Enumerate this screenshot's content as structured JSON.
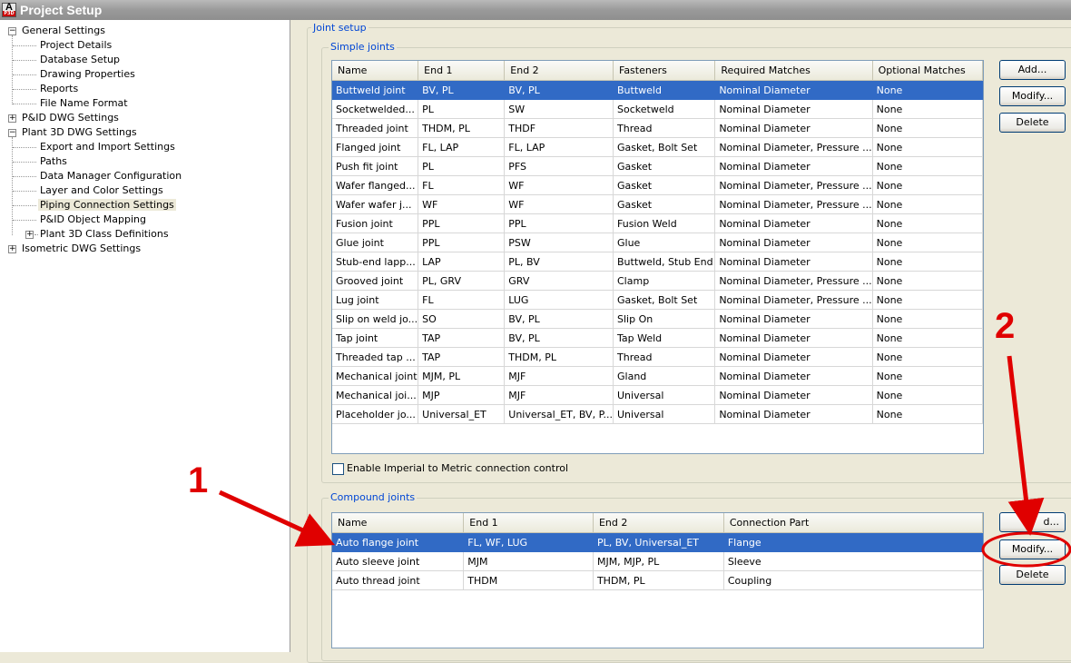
{
  "window": {
    "title": "Project Setup",
    "icon": "autocad-plant3d-icon"
  },
  "tree": [
    {
      "label": "General Settings",
      "level": 0,
      "expander": "minus"
    },
    {
      "label": "Project Details",
      "level": 1
    },
    {
      "label": "Database Setup",
      "level": 1
    },
    {
      "label": "Drawing Properties",
      "level": 1
    },
    {
      "label": "Reports",
      "level": 1
    },
    {
      "label": "File Name Format",
      "level": 1
    },
    {
      "label": "P&ID DWG Settings",
      "level": 0,
      "expander": "plus"
    },
    {
      "label": "Plant 3D DWG Settings",
      "level": 0,
      "expander": "minus"
    },
    {
      "label": "Export and Import Settings",
      "level": 1
    },
    {
      "label": "Paths",
      "level": 1
    },
    {
      "label": "Data Manager Configuration",
      "level": 1
    },
    {
      "label": "Layer and Color Settings",
      "level": 1
    },
    {
      "label": "Piping Connection Settings",
      "level": 1,
      "selected": true
    },
    {
      "label": "P&ID Object Mapping",
      "level": 1
    },
    {
      "label": "Plant 3D Class Definitions",
      "level": 1,
      "expander": "plus"
    },
    {
      "label": "Isometric DWG Settings",
      "level": 0,
      "expander": "plus"
    }
  ],
  "joint_setup": {
    "caption": "Joint setup"
  },
  "simple_joints": {
    "caption": "Simple joints",
    "columns": [
      "Name",
      "End 1",
      "End 2",
      "Fasteners",
      "Required Matches",
      "Optional Matches"
    ],
    "rows": [
      [
        "Buttweld joint",
        "BV, PL",
        "BV, PL",
        "Buttweld",
        "Nominal Diameter",
        "None"
      ],
      [
        "Socketwelded...",
        "PL",
        "SW",
        "Socketweld",
        "Nominal Diameter",
        "None"
      ],
      [
        "Threaded joint",
        "THDM, PL",
        "THDF",
        "Thread",
        "Nominal Diameter",
        "None"
      ],
      [
        "Flanged joint",
        "FL, LAP",
        "FL, LAP",
        "Gasket, Bolt Set",
        "Nominal Diameter, Pressure ...",
        "None"
      ],
      [
        "Push fit joint",
        "PL",
        "PFS",
        "Gasket",
        "Nominal Diameter",
        "None"
      ],
      [
        "Wafer flanged...",
        "FL",
        "WF",
        "Gasket",
        "Nominal Diameter, Pressure ...",
        "None"
      ],
      [
        "Wafer wafer j...",
        "WF",
        "WF",
        "Gasket",
        "Nominal Diameter, Pressure ...",
        "None"
      ],
      [
        "Fusion joint",
        "PPL",
        "PPL",
        "Fusion Weld",
        "Nominal Diameter",
        "None"
      ],
      [
        "Glue joint",
        "PPL",
        "PSW",
        "Glue",
        "Nominal Diameter",
        "None"
      ],
      [
        "Stub-end lapp...",
        "LAP",
        "PL, BV",
        "Buttweld, Stub End",
        "Nominal Diameter",
        "None"
      ],
      [
        "Grooved joint",
        "PL, GRV",
        "GRV",
        "Clamp",
        "Nominal Diameter, Pressure ...",
        "None"
      ],
      [
        "Lug joint",
        "FL",
        "LUG",
        "Gasket, Bolt Set",
        "Nominal Diameter, Pressure ...",
        "None"
      ],
      [
        "Slip on weld jo...",
        "SO",
        "BV, PL",
        "Slip On",
        "Nominal Diameter",
        "None"
      ],
      [
        "Tap joint",
        "TAP",
        "BV, PL",
        "Tap Weld",
        "Nominal Diameter",
        "None"
      ],
      [
        "Threaded tap ...",
        "TAP",
        "THDM, PL",
        "Thread",
        "Nominal Diameter",
        "None"
      ],
      [
        "Mechanical joint",
        "MJM, PL",
        "MJF",
        "Gland",
        "Nominal Diameter",
        "None"
      ],
      [
        "Mechanical joi...",
        "MJP",
        "MJF",
        "Universal",
        "Nominal Diameter",
        "None"
      ],
      [
        "Placeholder jo...",
        "Universal_ET",
        "Universal_ET, BV, P...",
        "Universal",
        "Nominal Diameter",
        "None"
      ]
    ],
    "selected_row": 0,
    "buttons": {
      "add": "Add...",
      "modify": "Modify...",
      "delete": "Delete"
    }
  },
  "imperial_metric": {
    "label": "Enable Imperial to Metric connection control",
    "checked": false
  },
  "compound_joints": {
    "caption": "Compound joints",
    "columns": [
      "Name",
      "End 1",
      "End 2",
      "Connection Part"
    ],
    "rows": [
      [
        "Auto flange joint",
        "FL, WF, LUG",
        "PL, BV, Universal_ET",
        "Flange"
      ],
      [
        "Auto sleeve joint",
        "MJM",
        "MJM, MJP, PL",
        "Sleeve"
      ],
      [
        "Auto thread joint",
        "THDM",
        "THDM, PL",
        "Coupling"
      ]
    ],
    "selected_row": 0,
    "buttons": {
      "add": "Add...",
      "modify": "Modify...",
      "delete": "Delete"
    },
    "add_visible": "d..."
  },
  "annotations": {
    "one": "1",
    "two": "2",
    "color": "#e00000"
  }
}
